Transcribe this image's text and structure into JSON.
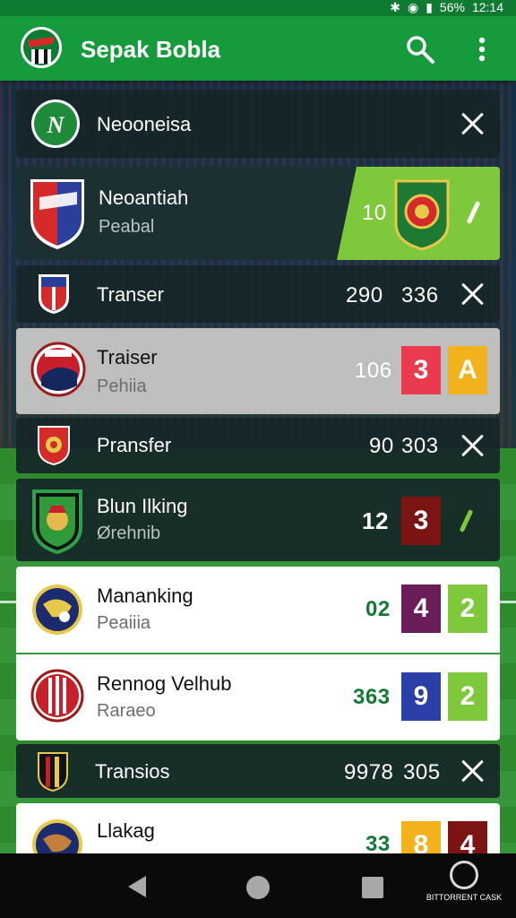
{
  "status_bar": {
    "icons": [
      "bluetooth-icon",
      "vibrate-icon",
      "signal-icon",
      "battery-icon"
    ],
    "battery_text": "56%",
    "time": "12:14"
  },
  "app_bar": {
    "title": "Sepak Bobla",
    "search_icon": "search-icon",
    "more_icon": "more-vert-icon"
  },
  "rows": [
    {
      "name": "Neooneisa",
      "action": "close"
    },
    {
      "name": "Neoantiah",
      "sub": "Peabal",
      "score": "10"
    },
    {
      "name": "Transer",
      "score": "290",
      "score2": "336",
      "action": "close"
    },
    {
      "name": "Traiser",
      "sub": "Pehiia",
      "score": "106",
      "box1": "3",
      "box2": "A"
    },
    {
      "name": "Pransfer",
      "score": "90",
      "score2": "303",
      "action": "close"
    },
    {
      "name": "Blun Ilking",
      "sub": "Ørehnib",
      "score": "12",
      "box1": "3"
    },
    {
      "name": "Mananking",
      "sub": "Peaiiia",
      "score": "02",
      "box1": "4",
      "box2": "2"
    },
    {
      "name": "Rennog Velhub",
      "sub": "Raraeo",
      "score": "363",
      "box1": "9",
      "box2": "2"
    },
    {
      "name": "Transios",
      "score": "9978",
      "score2": "305",
      "action": "close"
    },
    {
      "name": "Llakag",
      "score": "33",
      "box1": "8",
      "box2": "4"
    }
  ],
  "colors": {
    "app_bar": "#159b3c",
    "status_bar": "#0f7a32",
    "accent_green": "#7ec83c",
    "red_box": "#ea3b4e",
    "yellow_box": "#f2b21c",
    "maroon_box": "#7c1414",
    "purple_box": "#6b1d5a",
    "blue_box": "#2c3ea8",
    "score_green": "#137a35"
  },
  "nav_bar": {
    "icons": [
      "back-icon",
      "home-icon",
      "recent-apps-icon"
    ]
  },
  "watermark": {
    "text": "BITTORRENT CASK"
  }
}
